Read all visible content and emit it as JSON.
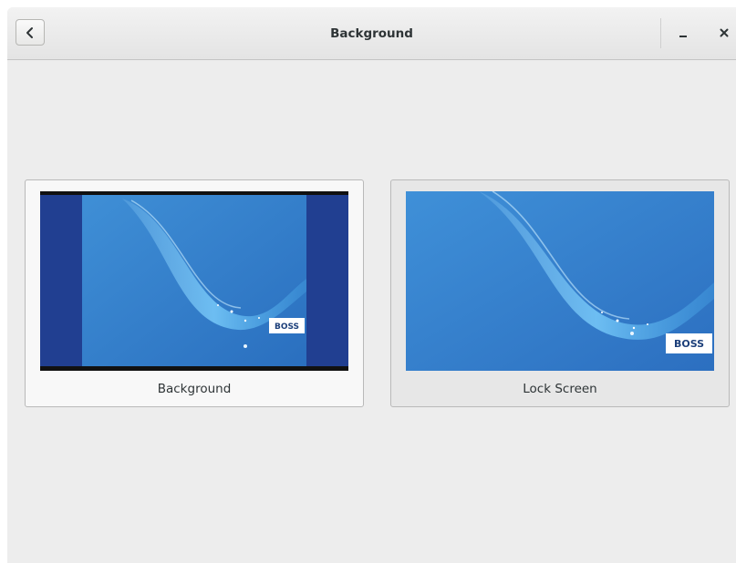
{
  "header": {
    "title": "Background"
  },
  "cards": [
    {
      "label": "Background",
      "thumb_logo": "BOSS"
    },
    {
      "label": "Lock Screen",
      "thumb_logo": "BOSS"
    }
  ],
  "colors": {
    "window_bg": "#ededed",
    "wallpaper_blue": "#2f7fc9",
    "side_panel": "#213f91"
  }
}
